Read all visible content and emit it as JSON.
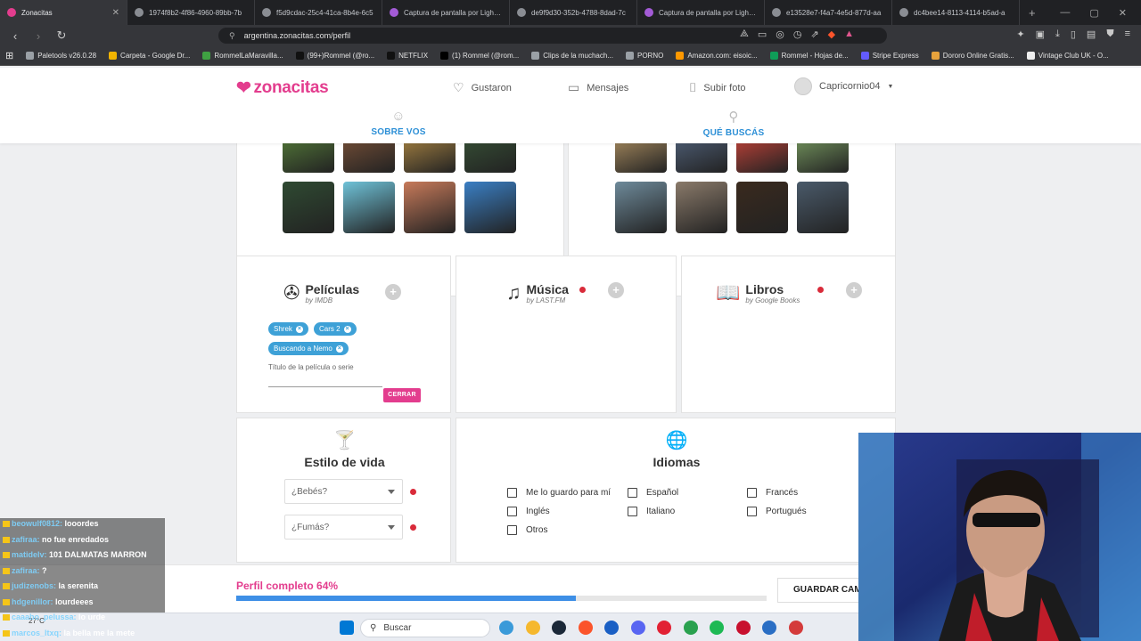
{
  "browser": {
    "tabs": [
      {
        "title": "Zonacitas",
        "active": true
      },
      {
        "title": "1974f8b2-4f86-4960-89bb-7b",
        "active": false
      },
      {
        "title": "f5d9cdac-25c4-41ca-8b4e-6c5",
        "active": false
      },
      {
        "title": "Captura de pantalla por Lightsh",
        "active": false
      },
      {
        "title": "de9f9d30-352b-4788-8dad-7c",
        "active": false
      },
      {
        "title": "Captura de pantalla por Lightsh",
        "active": false
      },
      {
        "title": "e13528e7-f4a7-4e5d-877d-aa",
        "active": false
      },
      {
        "title": "dc4bee14-8113-4114-b5ad-a",
        "active": false
      }
    ],
    "new_tab": "+",
    "url": "argentina.zonacitas.com/perfil",
    "bookmarks": [
      "Paletools v26.0.28",
      "Carpeta - Google Dr...",
      "RommelLaMaravilla...",
      "(99+)Rommel (@ro...",
      "NETFLIX",
      "(1) Rommel (@rom...",
      "Clips de la muchach...",
      "PORNO",
      "Amazon.com: eisoic...",
      "Rommel - Hojas de...",
      "Stripe Express",
      "Dororo Online Gratis...",
      "Vintage Club UK - O..."
    ]
  },
  "header": {
    "logo": "zonacitas",
    "nav": [
      {
        "label": "Gustaron",
        "icon": "heart-icon"
      },
      {
        "label": "Mensajes",
        "icon": "message-icon"
      },
      {
        "label": "Subir foto",
        "icon": "camera-icon"
      }
    ],
    "username": "Capricornio04",
    "subtabs": [
      {
        "label": "SOBRE VOS",
        "icon": "smile-icon"
      },
      {
        "label": "QUÉ BUSCÁS",
        "icon": "search-icon"
      }
    ]
  },
  "photos_left_colors": [
    "#5f8e3e",
    "#8a5a3c",
    "#c79a4a",
    "#3b5a3a",
    "#2f4a32",
    "#6fc2d8",
    "#c77a5a",
    "#3a7fc4"
  ],
  "photos_right_colors": [
    "#c9a56e",
    "#5a6e8c",
    "#e84a3e",
    "#8ab46e",
    "#6e8a9a",
    "#8a7a6a",
    "#3a2a1e",
    "#4a5a6a"
  ],
  "peliculas": {
    "title": "Películas",
    "by": "by IMDB",
    "chips": [
      "Shrek",
      "Cars 2",
      "Buscando a Nemo"
    ],
    "field_label": "Título de la película o serie",
    "close_label": "CERRAR"
  },
  "musica": {
    "title": "Música",
    "by": "by LAST.FM"
  },
  "libros": {
    "title": "Libros",
    "by": "by Google Books"
  },
  "estilo": {
    "title": "Estilo de vida",
    "selects": [
      "¿Bebés?",
      "¿Fumás?"
    ]
  },
  "idiomas": {
    "title": "Idiomas",
    "options": [
      "Me lo guardo para mí",
      "Español",
      "Francés",
      "Inglés",
      "Italiano",
      "Portugués",
      "Otros"
    ]
  },
  "progress": {
    "label": "Perfil completo 64%",
    "value": 0.64,
    "save_label": "GUARDAR CAMBIOS"
  },
  "chat": [
    {
      "user": "beowulf0812:",
      "msg": "looordes"
    },
    {
      "user": "zafiraa:",
      "msg": "no fue enredados"
    },
    {
      "user": "matidelv:",
      "msg": "101 DALMATAS MARRON"
    },
    {
      "user": "zafiraa:",
      "msg": "?"
    },
    {
      "user": "judizenobs:",
      "msg": "la serenita"
    },
    {
      "user": "hdgenillor:",
      "msg": "lourdeees"
    },
    {
      "user": "caaabo_pelussa:",
      "msg": "lo urde"
    },
    {
      "user": "marcos_ltxq:",
      "msg": "la bella me la mete"
    }
  ],
  "taskbar": {
    "search": "Buscar",
    "weather": "27°C",
    "icon_colors": [
      "#0078d4",
      "#3a9ad9",
      "#f5b82e",
      "#1b2838",
      "#fb542b",
      "#1a5fc4",
      "#5865f2",
      "#e22134",
      "#2aa14f",
      "#1db954",
      "#c8102e",
      "#2a6ec4",
      "#d43b3b"
    ]
  }
}
